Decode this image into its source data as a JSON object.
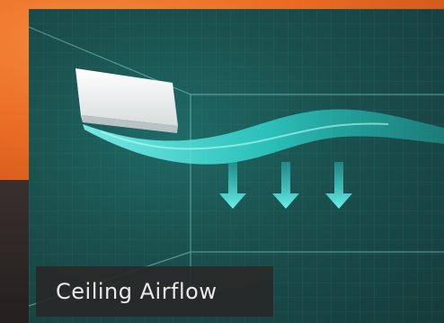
{
  "caption": {
    "label": "Ceiling Airflow"
  },
  "visual": {
    "unit_icon": "wall-mounted-ac-unit-icon",
    "airflow_icon": "airflow-stream-icon",
    "arrow_icon": "down-arrow-icon",
    "arrow_count": 3,
    "colors": {
      "accent": "#2fd3cc",
      "panel": "#1a4f4d",
      "orange": "#e96a23",
      "caption_bg": "#282828"
    }
  }
}
